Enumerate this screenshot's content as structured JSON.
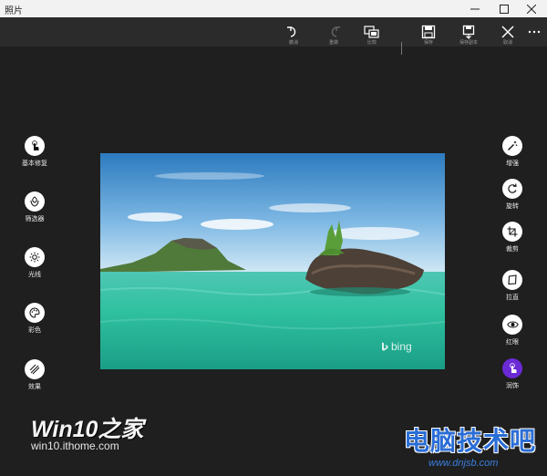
{
  "app": {
    "title": "照片"
  },
  "window_controls": [
    "minimize-icon",
    "maximize-icon",
    "close-icon"
  ],
  "toolbar": {
    "items": [
      {
        "icon": "undo-icon",
        "caption": "撤消"
      },
      {
        "icon": "redo-icon",
        "caption": "重做"
      },
      {
        "icon": "compare-icon",
        "caption": "比较"
      },
      {
        "icon": "save-icon",
        "caption": "保存"
      },
      {
        "icon": "save-copy-icon",
        "caption": "保存副本"
      },
      {
        "icon": "cancel-icon",
        "caption": "取消"
      },
      {
        "icon": "more-icon",
        "caption": ""
      }
    ]
  },
  "left_tools": [
    {
      "label": "基本修复",
      "icon": "hand-touch-icon",
      "selected": true
    },
    {
      "label": "筛选器",
      "icon": "filter-icon",
      "selected": false
    },
    {
      "label": "光线",
      "icon": "sun-icon",
      "selected": false
    },
    {
      "label": "彩色",
      "icon": "palette-icon",
      "selected": false
    },
    {
      "label": "效果",
      "icon": "effects-icon",
      "selected": false
    }
  ],
  "right_tools": [
    {
      "label": "增强",
      "icon": "magic-wand-icon",
      "active": false
    },
    {
      "label": "旋转",
      "icon": "rotate-icon",
      "active": false
    },
    {
      "label": "裁剪",
      "icon": "crop-icon",
      "active": false
    },
    {
      "label": "拉直",
      "icon": "straighten-icon",
      "active": false
    },
    {
      "label": "红眼",
      "icon": "eye-icon",
      "active": false
    },
    {
      "label": "润饰",
      "icon": "retouch-icon",
      "active": true
    }
  ],
  "photo": {
    "watermark": "bing"
  },
  "colors": {
    "accent": "#6a2ad6",
    "background": "#1f1f1f",
    "toolbar": "#2b2b2b"
  },
  "site_watermarks": {
    "left_title": "Win10之家",
    "left_url": "win10.ithome.com",
    "right_title": "电脑技术吧",
    "right_url": "www.dnjsb.com"
  }
}
